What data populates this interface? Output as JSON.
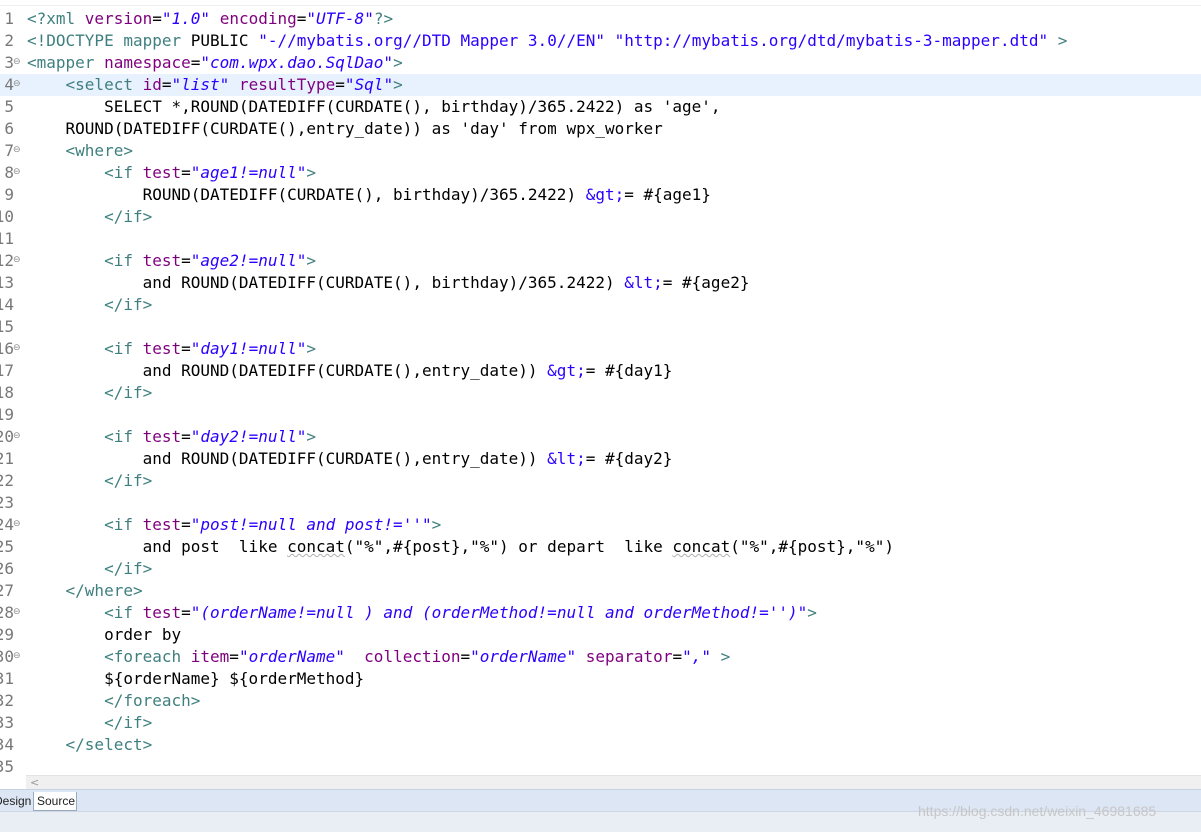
{
  "editor": {
    "current_line": 4,
    "lines": [
      {
        "n": "1",
        "fold": false,
        "parts": [
          [
            "decl",
            "<?xml "
          ],
          [
            "attr",
            "version"
          ],
          [
            "text",
            "="
          ],
          [
            "val",
            "\"1.0\""
          ],
          [
            "text",
            " "
          ],
          [
            "attr",
            "encoding"
          ],
          [
            "text",
            "="
          ],
          [
            "val",
            "\"UTF-8\""
          ],
          [
            "decl",
            "?>"
          ]
        ]
      },
      {
        "n": "2",
        "fold": false,
        "parts": [
          [
            "dtd",
            "<!DOCTYPE mapper "
          ],
          [
            "text",
            "PUBLIC "
          ],
          [
            "str",
            "\"-//mybatis.org//DTD Mapper 3.0//EN\""
          ],
          [
            "text",
            " "
          ],
          [
            "str",
            "\"http://mybatis.org/dtd/mybatis-3-mapper.dtd\""
          ],
          [
            "dtd",
            " >"
          ]
        ]
      },
      {
        "n": "3",
        "fold": true,
        "parts": [
          [
            "tag",
            "<mapper "
          ],
          [
            "attr",
            "namespace"
          ],
          [
            "text",
            "="
          ],
          [
            "val",
            "\"com.wpx.dao.SqlDao\""
          ],
          [
            "tag",
            ">"
          ]
        ]
      },
      {
        "n": "4",
        "fold": true,
        "parts": [
          [
            "text",
            "    "
          ],
          [
            "tag",
            "<select "
          ],
          [
            "attr",
            "id"
          ],
          [
            "text",
            "="
          ],
          [
            "val",
            "\"list\""
          ],
          [
            "text",
            " "
          ],
          [
            "attr",
            "resultType"
          ],
          [
            "text",
            "="
          ],
          [
            "val",
            "\"Sql\""
          ],
          [
            "tag",
            ">"
          ]
        ]
      },
      {
        "n": "5",
        "fold": false,
        "parts": [
          [
            "text",
            "        SELECT *,ROUND(DATEDIFF(CURDATE(), birthday)/365.2422) as 'age',"
          ]
        ]
      },
      {
        "n": "6",
        "fold": false,
        "parts": [
          [
            "text",
            "    ROUND(DATEDIFF(CURDATE(),entry_date)) as 'day' from wpx_worker"
          ]
        ]
      },
      {
        "n": "7",
        "fold": true,
        "parts": [
          [
            "text",
            "    "
          ],
          [
            "tag",
            "<where>"
          ]
        ]
      },
      {
        "n": "8",
        "fold": true,
        "parts": [
          [
            "text",
            "        "
          ],
          [
            "tag",
            "<if "
          ],
          [
            "attr",
            "test"
          ],
          [
            "text",
            "="
          ],
          [
            "val",
            "\"age1!=null\""
          ],
          [
            "tag",
            ">"
          ]
        ]
      },
      {
        "n": "9",
        "fold": false,
        "parts": [
          [
            "text",
            "            ROUND(DATEDIFF(CURDATE(), birthday)/365.2422) "
          ],
          [
            "ent",
            "&gt;"
          ],
          [
            "text",
            "= #{age1}"
          ]
        ]
      },
      {
        "n": "10",
        "fold": false,
        "parts": [
          [
            "text",
            "        "
          ],
          [
            "tag",
            "</if>"
          ]
        ]
      },
      {
        "n": "11",
        "fold": false,
        "parts": [
          [
            "text",
            ""
          ]
        ]
      },
      {
        "n": "12",
        "fold": true,
        "parts": [
          [
            "text",
            "        "
          ],
          [
            "tag",
            "<if "
          ],
          [
            "attr",
            "test"
          ],
          [
            "text",
            "="
          ],
          [
            "val",
            "\"age2!=null\""
          ],
          [
            "tag",
            ">"
          ]
        ]
      },
      {
        "n": "13",
        "fold": false,
        "parts": [
          [
            "text",
            "            and ROUND(DATEDIFF(CURDATE(), birthday)/365.2422) "
          ],
          [
            "ent",
            "&lt;"
          ],
          [
            "text",
            "= #{age2}"
          ]
        ]
      },
      {
        "n": "14",
        "fold": false,
        "parts": [
          [
            "text",
            "        "
          ],
          [
            "tag",
            "</if>"
          ]
        ]
      },
      {
        "n": "15",
        "fold": false,
        "parts": [
          [
            "text",
            ""
          ]
        ]
      },
      {
        "n": "16",
        "fold": true,
        "parts": [
          [
            "text",
            "        "
          ],
          [
            "tag",
            "<if "
          ],
          [
            "attr",
            "test"
          ],
          [
            "text",
            "="
          ],
          [
            "val",
            "\"day1!=null\""
          ],
          [
            "tag",
            ">"
          ]
        ]
      },
      {
        "n": "17",
        "fold": false,
        "parts": [
          [
            "text",
            "            and ROUND(DATEDIFF(CURDATE(),entry_date)) "
          ],
          [
            "ent",
            "&gt;"
          ],
          [
            "text",
            "= #{day1}"
          ]
        ]
      },
      {
        "n": "18",
        "fold": false,
        "parts": [
          [
            "text",
            "        "
          ],
          [
            "tag",
            "</if>"
          ]
        ]
      },
      {
        "n": "19",
        "fold": false,
        "parts": [
          [
            "text",
            ""
          ]
        ]
      },
      {
        "n": "20",
        "fold": true,
        "parts": [
          [
            "text",
            "        "
          ],
          [
            "tag",
            "<if "
          ],
          [
            "attr",
            "test"
          ],
          [
            "text",
            "="
          ],
          [
            "val",
            "\"day2!=null\""
          ],
          [
            "tag",
            ">"
          ]
        ]
      },
      {
        "n": "21",
        "fold": false,
        "parts": [
          [
            "text",
            "            and ROUND(DATEDIFF(CURDATE(),entry_date)) "
          ],
          [
            "ent",
            "&lt;"
          ],
          [
            "text",
            "= #{day2}"
          ]
        ]
      },
      {
        "n": "22",
        "fold": false,
        "parts": [
          [
            "text",
            "        "
          ],
          [
            "tag",
            "</if>"
          ]
        ]
      },
      {
        "n": "23",
        "fold": false,
        "parts": [
          [
            "text",
            ""
          ]
        ]
      },
      {
        "n": "24",
        "fold": true,
        "parts": [
          [
            "text",
            "        "
          ],
          [
            "tag",
            "<if "
          ],
          [
            "attr",
            "test"
          ],
          [
            "text",
            "="
          ],
          [
            "val",
            "\"post!=null and post!=''\""
          ],
          [
            "tag",
            ">"
          ]
        ]
      },
      {
        "n": "25",
        "fold": false,
        "parts": [
          [
            "text",
            "            and post  like "
          ],
          [
            "squig",
            "concat"
          ],
          [
            "text",
            "(\"%\",#{post},\"%\") or depart  like "
          ],
          [
            "squig",
            "concat"
          ],
          [
            "text",
            "(\"%\",#{post},\"%\")"
          ]
        ]
      },
      {
        "n": "26",
        "fold": false,
        "parts": [
          [
            "text",
            "        "
          ],
          [
            "tag",
            "</if>"
          ]
        ]
      },
      {
        "n": "27",
        "fold": false,
        "parts": [
          [
            "text",
            "    "
          ],
          [
            "tag",
            "</where>"
          ]
        ]
      },
      {
        "n": "28",
        "fold": true,
        "parts": [
          [
            "text",
            "        "
          ],
          [
            "tag",
            "<if "
          ],
          [
            "attr",
            "test"
          ],
          [
            "text",
            "="
          ],
          [
            "val",
            "\"(orderName!=null ) and (orderMethod!=null and orderMethod!='')\""
          ],
          [
            "tag",
            ">"
          ]
        ]
      },
      {
        "n": "29",
        "fold": false,
        "parts": [
          [
            "text",
            "        order by"
          ]
        ]
      },
      {
        "n": "30",
        "fold": true,
        "parts": [
          [
            "text",
            "        "
          ],
          [
            "tag",
            "<foreach "
          ],
          [
            "attr",
            "item"
          ],
          [
            "text",
            "="
          ],
          [
            "val",
            "\"orderName\""
          ],
          [
            "text",
            "  "
          ],
          [
            "attr",
            "collection"
          ],
          [
            "text",
            "="
          ],
          [
            "val",
            "\"orderName\""
          ],
          [
            "text",
            " "
          ],
          [
            "attr",
            "separator"
          ],
          [
            "text",
            "="
          ],
          [
            "val",
            "\",\""
          ],
          [
            "tag",
            " >"
          ]
        ]
      },
      {
        "n": "31",
        "fold": false,
        "parts": [
          [
            "text",
            "        ${orderName} ${orderMethod}"
          ]
        ]
      },
      {
        "n": "32",
        "fold": false,
        "parts": [
          [
            "text",
            "        "
          ],
          [
            "tag",
            "</foreach>"
          ]
        ]
      },
      {
        "n": "33",
        "fold": false,
        "parts": [
          [
            "text",
            "        "
          ],
          [
            "tag",
            "</if>"
          ]
        ]
      },
      {
        "n": "34",
        "fold": false,
        "parts": [
          [
            "text",
            "    "
          ],
          [
            "tag",
            "</select>"
          ]
        ]
      },
      {
        "n": "35",
        "fold": false,
        "parts": [
          [
            "text",
            ""
          ]
        ]
      }
    ]
  },
  "tabs": {
    "design_label": "Design",
    "source_label": "Source"
  },
  "scrollbar": {
    "left_arrow": "<"
  },
  "watermark": "https://blog.csdn.net/weixin_46981685",
  "colors": {
    "tag": "#3f7f7f",
    "attribute": "#7f007f",
    "attribute_value": "#2a00ff",
    "current_line": "#e8f2fe",
    "gutter_number": "#787878"
  }
}
